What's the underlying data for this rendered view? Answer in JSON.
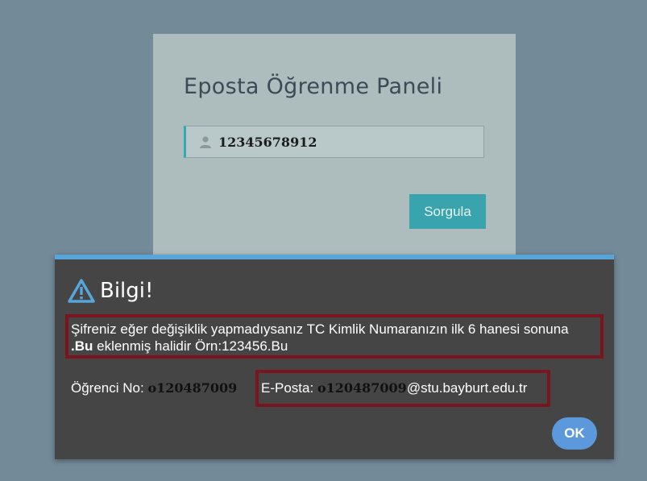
{
  "login_panel": {
    "title": "Eposta Öğrenme Paneli",
    "tc_input_value": "12345678912",
    "submit_label": "Sorgula"
  },
  "dialog": {
    "title": "Bilgi!",
    "message_line1": "Şifreniz eğer değişiklik yapmadıysanız TC Kimlik Numaranızın ilk 6 hanesi sonuna",
    "message_suffix": ".Bu",
    "message_line2_rest": " eklenmiş halidir Örn:123456.Bu",
    "student_no_label": "Öğrenci No:",
    "student_no_value": "o120487009",
    "email_label": "E-Posta:",
    "email_user": "o120487009",
    "email_domain": "@stu.bayburt.edu.tr",
    "ok_label": "OK"
  },
  "icons": {
    "user": "user-icon",
    "warning": "warning-triangle-icon"
  },
  "colors": {
    "background": "#738a99",
    "panel": "#adbdbd",
    "accent_teal": "#3aa4ae",
    "dialog_bg": "#454545",
    "dialog_top_border": "#57a5d9",
    "highlight_red": "#7a1520",
    "ok_blue": "#5b99dc"
  }
}
